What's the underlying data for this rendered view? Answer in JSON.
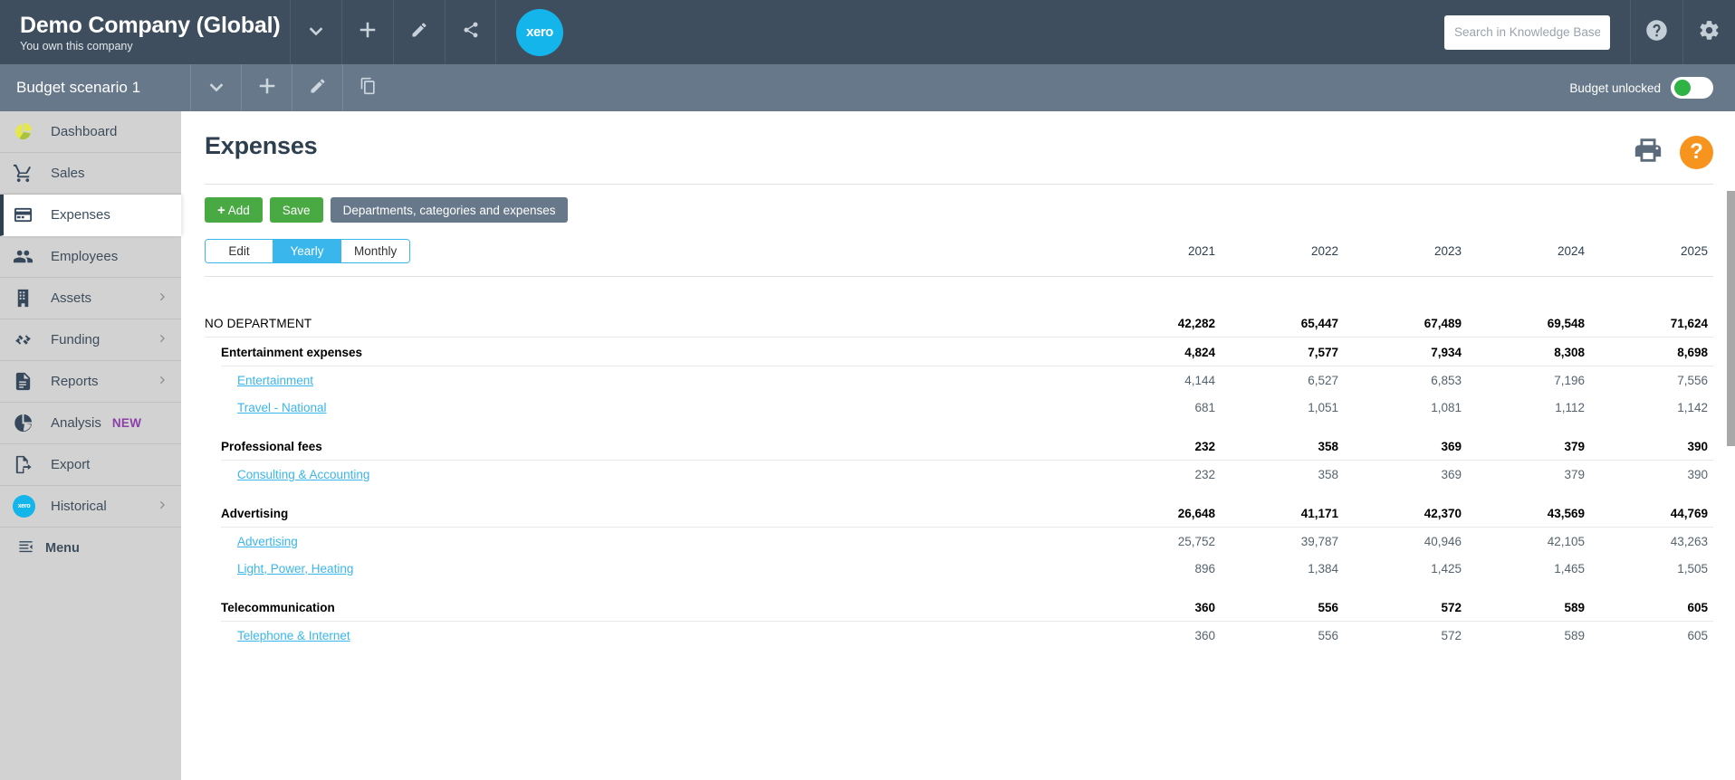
{
  "topbar": {
    "company_name": "Demo Company (Global)",
    "company_sub": "You own this company",
    "actions": [
      {
        "name": "chevron-down-icon",
        "label": "Select company"
      },
      {
        "name": "plus-icon",
        "label": "Add company"
      },
      {
        "name": "pencil-icon",
        "label": "Edit company"
      },
      {
        "name": "share-icon",
        "label": "Share company"
      }
    ],
    "brand_logo": "xero",
    "search_placeholder": "Search in Knowledge Base",
    "search_value": "",
    "help_icon": "question-mark-icon",
    "settings_icon": "gear-icon"
  },
  "scenariobar": {
    "scenario_name": "Budget scenario 1",
    "actions": [
      {
        "name": "chevron-down-icon",
        "label": "Select scenario"
      },
      {
        "name": "plus-icon",
        "label": "Add scenario"
      },
      {
        "name": "pencil-icon",
        "label": "Edit scenario"
      },
      {
        "name": "copy-icon",
        "label": "Copy scenario"
      }
    ],
    "lock_label": "Budget unlocked",
    "lock_state": "on",
    "toggle_color": "#2fb344"
  },
  "sidebar": {
    "items": [
      {
        "label": "Dashboard",
        "icon": "pie-chart-icon",
        "active": false,
        "chevron": false,
        "badge": ""
      },
      {
        "label": "Sales",
        "icon": "shopping-cart-icon",
        "active": false,
        "chevron": false,
        "badge": ""
      },
      {
        "label": "Expenses",
        "icon": "credit-card-icon",
        "active": true,
        "chevron": false,
        "badge": ""
      },
      {
        "label": "Employees",
        "icon": "people-icon",
        "active": false,
        "chevron": false,
        "badge": ""
      },
      {
        "label": "Assets",
        "icon": "building-icon",
        "active": false,
        "chevron": true,
        "badge": ""
      },
      {
        "label": "Funding",
        "icon": "handshake-icon",
        "active": false,
        "chevron": true,
        "badge": ""
      },
      {
        "label": "Reports",
        "icon": "document-icon",
        "active": false,
        "chevron": true,
        "badge": ""
      },
      {
        "label": "Analysis",
        "icon": "pie-slice-icon",
        "active": false,
        "chevron": false,
        "badge": "NEW"
      },
      {
        "label": "Export",
        "icon": "export-icon",
        "active": false,
        "chevron": false,
        "badge": ""
      },
      {
        "label": "Historical",
        "icon": "xero-circle-icon",
        "active": false,
        "chevron": true,
        "badge": ""
      }
    ],
    "menu_label": "Menu",
    "menu_icon": "collapse-menu-icon",
    "badge_color": "#8b3fa8"
  },
  "main": {
    "page_title": "Expenses",
    "print_icon": "printer-icon",
    "help_icon": "help-circle-icon",
    "help_glyph": "?",
    "buttons": {
      "add_label": "Add",
      "add_plus": "+",
      "save_label": "Save",
      "departments_label": "Departments, categories and expenses",
      "green": "#49a942",
      "grey": "#67788a"
    },
    "tabs": [
      {
        "label": "Edit",
        "active": false
      },
      {
        "label": "Yearly",
        "active": true
      },
      {
        "label": "Monthly",
        "active": false
      }
    ],
    "accent_blue": "#39b6ec",
    "years": [
      "2021",
      "2022",
      "2023",
      "2024",
      "2025"
    ],
    "rows": [
      {
        "type": "department",
        "label": "NO DEPARTMENT",
        "values": [
          "42,282",
          "65,447",
          "67,489",
          "69,548",
          "71,624"
        ],
        "rule_after": true
      },
      {
        "type": "category",
        "label": "Entertainment expenses",
        "values": [
          "4,824",
          "7,577",
          "7,934",
          "8,308",
          "8,698"
        ],
        "rule_after": true
      },
      {
        "type": "item",
        "label": "Entertainment",
        "values": [
          "4,144",
          "6,527",
          "6,853",
          "7,196",
          "7,556"
        ],
        "rule_after": false
      },
      {
        "type": "item",
        "label": "Travel - National",
        "values": [
          "681",
          "1,051",
          "1,081",
          "1,112",
          "1,142"
        ],
        "rule_after": false
      },
      {
        "type": "category",
        "label": "Professional fees",
        "values": [
          "232",
          "358",
          "369",
          "379",
          "390"
        ],
        "rule_after": true
      },
      {
        "type": "item",
        "label": "Consulting & Accounting",
        "values": [
          "232",
          "358",
          "369",
          "379",
          "390"
        ],
        "rule_after": false
      },
      {
        "type": "category",
        "label": "Advertising",
        "values": [
          "26,648",
          "41,171",
          "42,370",
          "43,569",
          "44,769"
        ],
        "rule_after": true
      },
      {
        "type": "item",
        "label": "Advertising",
        "values": [
          "25,752",
          "39,787",
          "40,946",
          "42,105",
          "43,263"
        ],
        "rule_after": false
      },
      {
        "type": "item",
        "label": "Light, Power, Heating",
        "values": [
          "896",
          "1,384",
          "1,425",
          "1,465",
          "1,505"
        ],
        "rule_after": false
      },
      {
        "type": "category",
        "label": "Telecommunication",
        "values": [
          "360",
          "556",
          "572",
          "589",
          "605"
        ],
        "rule_after": true
      },
      {
        "type": "item",
        "label": "Telephone & Internet",
        "values": [
          "360",
          "556",
          "572",
          "589",
          "605"
        ],
        "rule_after": false
      }
    ]
  }
}
